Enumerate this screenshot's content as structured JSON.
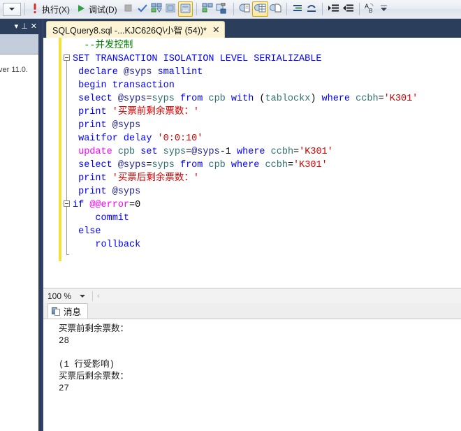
{
  "toolbar": {
    "combo_icon": "chevron-down-icon",
    "execute_label": "执行(X)",
    "execute_icon": "exclamation-icon",
    "debug_label": "调试(D)",
    "debug_icon": "play-triangle-icon",
    "buttons": [
      {
        "name": "stop-button",
        "icon": "stop-square-icon",
        "active": false
      },
      {
        "name": "parse-button",
        "icon": "check-mark-icon",
        "active": false
      },
      {
        "name": "display-estimated-plan-button",
        "icon": "estimated-plan-icon",
        "active": false
      },
      {
        "name": "query-options-button",
        "icon": "query-options-icon",
        "active": false
      },
      {
        "name": "include-actual-plan-button",
        "icon": "actual-plan-icon",
        "active": true
      },
      {
        "name": "include-client-statistics-button",
        "icon": "client-statistics-icon",
        "active": false
      },
      {
        "name": "intellisense-button",
        "icon": "intellisense-icon",
        "active": false
      },
      {
        "name": "results-to-text-button",
        "icon": "results-to-text-icon",
        "active": false
      },
      {
        "name": "results-to-grid-button",
        "icon": "results-to-grid-icon",
        "active": true
      },
      {
        "name": "results-to-file-button",
        "icon": "results-to-file-icon",
        "active": false
      },
      {
        "name": "comment-button",
        "icon": "comment-lines-icon",
        "active": false
      },
      {
        "name": "uncomment-button",
        "icon": "uncomment-lines-icon",
        "active": false
      },
      {
        "name": "increase-indent-button",
        "icon": "increase-indent-icon",
        "active": false
      },
      {
        "name": "decrease-indent-button",
        "icon": "decrease-indent-icon",
        "active": false
      },
      {
        "name": "spell-check-button",
        "icon": "a-to-b-icon",
        "active": false
      }
    ],
    "overflow_icon": "toolbar-overflow-icon"
  },
  "left_panel": {
    "autohide_icon": "chevron-down-icon",
    "pin_icon": "pin-icon",
    "close_icon": "close-icon",
    "truncated_text": "ver 11.0."
  },
  "editor_tab": {
    "title": "SQLQuery8.sql -...KJC626Q\\小智 (54))*",
    "close_icon": "close-icon"
  },
  "code": {
    "lines": [
      [
        {
          "t": "  ",
          "c": "plain"
        },
        {
          "t": "--并发控制",
          "c": "cmt"
        }
      ],
      [
        {
          "t": "SET TRANSACTION ISOLATION LEVEL SERIALIZABLE",
          "c": "kw"
        }
      ],
      [
        {
          "t": " ",
          "c": "plain"
        },
        {
          "t": "declare",
          "c": "kw"
        },
        {
          "t": " ",
          "c": "plain"
        },
        {
          "t": "@syps",
          "c": "var"
        },
        {
          "t": " ",
          "c": "plain"
        },
        {
          "t": "smallint",
          "c": "kw"
        }
      ],
      [
        {
          "t": " ",
          "c": "plain"
        },
        {
          "t": "begin transaction",
          "c": "kw"
        }
      ],
      [
        {
          "t": " ",
          "c": "plain"
        },
        {
          "t": "select",
          "c": "kw"
        },
        {
          "t": " ",
          "c": "plain"
        },
        {
          "t": "@syps",
          "c": "var"
        },
        {
          "t": "=",
          "c": "plain"
        },
        {
          "t": "syps",
          "c": "ident"
        },
        {
          "t": " ",
          "c": "plain"
        },
        {
          "t": "from",
          "c": "kw"
        },
        {
          "t": " ",
          "c": "plain"
        },
        {
          "t": "cpb",
          "c": "ident"
        },
        {
          "t": " ",
          "c": "plain"
        },
        {
          "t": "with",
          "c": "kw"
        },
        {
          "t": " (",
          "c": "plain"
        },
        {
          "t": "tablockx",
          "c": "ident"
        },
        {
          "t": ") ",
          "c": "plain"
        },
        {
          "t": "where",
          "c": "kw"
        },
        {
          "t": " ",
          "c": "plain"
        },
        {
          "t": "ccbh",
          "c": "ident"
        },
        {
          "t": "=",
          "c": "plain"
        },
        {
          "t": "'K301'",
          "c": "str"
        }
      ],
      [
        {
          "t": " ",
          "c": "plain"
        },
        {
          "t": "print",
          "c": "kw"
        },
        {
          "t": " ",
          "c": "plain"
        },
        {
          "t": "'买票前剩余票数：'",
          "c": "str"
        }
      ],
      [
        {
          "t": " ",
          "c": "plain"
        },
        {
          "t": "print",
          "c": "kw"
        },
        {
          "t": " ",
          "c": "plain"
        },
        {
          "t": "@syps",
          "c": "var"
        }
      ],
      [
        {
          "t": " ",
          "c": "plain"
        },
        {
          "t": "waitfor delay",
          "c": "kw"
        },
        {
          "t": " ",
          "c": "plain"
        },
        {
          "t": "'0:0:10'",
          "c": "str"
        }
      ],
      [
        {
          "t": " ",
          "c": "plain"
        },
        {
          "t": "update",
          "c": "kw2"
        },
        {
          "t": " ",
          "c": "plain"
        },
        {
          "t": "cpb",
          "c": "ident"
        },
        {
          "t": " ",
          "c": "plain"
        },
        {
          "t": "set",
          "c": "kw"
        },
        {
          "t": " ",
          "c": "plain"
        },
        {
          "t": "syps",
          "c": "ident"
        },
        {
          "t": "=",
          "c": "plain"
        },
        {
          "t": "@syps",
          "c": "var"
        },
        {
          "t": "-1 ",
          "c": "plain"
        },
        {
          "t": "where",
          "c": "kw"
        },
        {
          "t": " ",
          "c": "plain"
        },
        {
          "t": "ccbh",
          "c": "ident"
        },
        {
          "t": "=",
          "c": "plain"
        },
        {
          "t": "'K301'",
          "c": "str"
        }
      ],
      [
        {
          "t": " ",
          "c": "plain"
        },
        {
          "t": "select",
          "c": "kw"
        },
        {
          "t": " ",
          "c": "plain"
        },
        {
          "t": "@syps",
          "c": "var"
        },
        {
          "t": "=",
          "c": "plain"
        },
        {
          "t": "syps",
          "c": "ident"
        },
        {
          "t": " ",
          "c": "plain"
        },
        {
          "t": "from",
          "c": "kw"
        },
        {
          "t": " ",
          "c": "plain"
        },
        {
          "t": "cpb",
          "c": "ident"
        },
        {
          "t": " ",
          "c": "plain"
        },
        {
          "t": "where",
          "c": "kw"
        },
        {
          "t": " ",
          "c": "plain"
        },
        {
          "t": "ccbh",
          "c": "ident"
        },
        {
          "t": "=",
          "c": "plain"
        },
        {
          "t": "'K301'",
          "c": "str"
        }
      ],
      [
        {
          "t": " ",
          "c": "plain"
        },
        {
          "t": "print",
          "c": "kw"
        },
        {
          "t": " ",
          "c": "plain"
        },
        {
          "t": "'买票后剩余票数：'",
          "c": "str"
        }
      ],
      [
        {
          "t": " ",
          "c": "plain"
        },
        {
          "t": "print",
          "c": "kw"
        },
        {
          "t": " ",
          "c": "plain"
        },
        {
          "t": "@syps",
          "c": "var"
        }
      ],
      [
        {
          "t": "if",
          "c": "kw"
        },
        {
          "t": " ",
          "c": "plain"
        },
        {
          "t": "@@error",
          "c": "kw2"
        },
        {
          "t": "=0",
          "c": "plain"
        }
      ],
      [
        {
          "t": "    ",
          "c": "plain"
        },
        {
          "t": "commit",
          "c": "kw"
        }
      ],
      [
        {
          "t": " ",
          "c": "plain"
        },
        {
          "t": "else",
          "c": "kw"
        }
      ],
      [
        {
          "t": "    ",
          "c": "plain"
        },
        {
          "t": "rollback",
          "c": "kw"
        }
      ]
    ]
  },
  "zoombar": {
    "zoom_value": "100 %",
    "caret_icon": "chevron-down-icon",
    "prev_icon": "chevron-left-icon"
  },
  "results": {
    "tab_label": "消息",
    "tab_icon": "message-doc-icon",
    "lines": [
      "买票前剩余票数：",
      "28",
      "",
      "(1 行受影响)",
      "买票后剩余票数：",
      "27"
    ]
  },
  "colors": {
    "accent_tab": "#fdf4d6",
    "chrome_dark": "#2b3f5c",
    "keyword": "#0000ff",
    "string": "#d40000",
    "comment": "#008000",
    "magenta_keyword": "#ff00ff",
    "change_bar": "#f2e03c"
  }
}
